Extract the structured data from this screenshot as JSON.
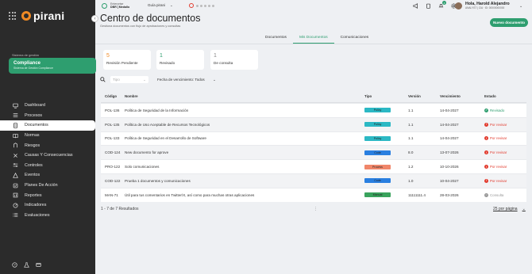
{
  "brand": {
    "name": "pirani"
  },
  "sidebar": {
    "system_caption": "Sistema de gestión",
    "system_title": "Compliance",
    "system_subtitle": "Sistema de Gestión Compliance",
    "items": [
      {
        "label": "Dashboard",
        "icon": "monitor-icon",
        "active": false
      },
      {
        "label": "Procesos",
        "icon": "process-icon",
        "active": false
      },
      {
        "label": "Documentos",
        "icon": "document-icon",
        "active": true
      },
      {
        "label": "Normas",
        "icon": "book-icon",
        "active": false
      },
      {
        "label": "Riesgos",
        "icon": "risk-icon",
        "active": false
      },
      {
        "label": "Causas Y Consecuencias",
        "icon": "cause-icon",
        "active": false
      },
      {
        "label": "Controles",
        "icon": "controls-icon",
        "active": false
      },
      {
        "label": "Eventos",
        "icon": "alert-icon",
        "active": false
      },
      {
        "label": "Planes De Acción",
        "icon": "plan-icon",
        "active": false
      },
      {
        "label": "Reportes",
        "icon": "report-icon",
        "active": false
      },
      {
        "label": "Indicadores",
        "icon": "indicator-icon",
        "active": false
      },
      {
        "label": "Evaluaciones",
        "icon": "evaluation-icon",
        "active": false
      }
    ]
  },
  "topbar": {
    "company_line1": "Enterprise",
    "company_line2": "DBR | Medallo",
    "guide_label": "Guía pirani",
    "user_name": "Hola, Harold Alejandro",
    "user_role": "ANALYST | CIA · ID: 00000000000",
    "notification_count": "4"
  },
  "header": {
    "title": "Centro de documentos",
    "subtitle": "Gestiona documentos con flujo de aprobaciones y consultas",
    "new_button": "Nuevo documento"
  },
  "tabs": [
    {
      "label": "Documentos",
      "active": false
    },
    {
      "label": "Mis Documentos",
      "active": true
    },
    {
      "label": "Comunicaciones",
      "active": false
    }
  ],
  "stats": [
    {
      "value": "5",
      "label": "Revisión Pendiente",
      "color": "#f08a24"
    },
    {
      "value": "1",
      "label": "Revisado",
      "color": "#2e9e6f"
    },
    {
      "value": "1",
      "label": "De consulta",
      "color": "#888888"
    }
  ],
  "filters": {
    "type_placeholder": "Tipo",
    "date_filter": "Fecha de vencimiento: Todos"
  },
  "table": {
    "headers": [
      "Código",
      "Nombre",
      "Tipo",
      "Versión",
      "Vencimiento",
      "Estado"
    ],
    "rows": [
      {
        "code": "POL-136",
        "name": "Política de Seguridad de la Información",
        "type": "Policy",
        "type_color": "#2bb8c4",
        "version": "1.1",
        "due": "14-04-2027",
        "status": "Revisado",
        "status_color": "#2e9e6f",
        "status_icon": "✓"
      },
      {
        "code": "POL-135",
        "name": "Política de Uso Aceptable de Recursos Tecnológicos",
        "type": "Policy",
        "type_color": "#2bb8c4",
        "version": "1.1",
        "due": "14-04-2027",
        "status": "Por revisar",
        "status_color": "#e23b2e",
        "status_icon": "!"
      },
      {
        "code": "POL-133",
        "name": "Política de Seguridad en el Desarrollo de Software",
        "type": "Policy",
        "type_color": "#2bb8c4",
        "version": "1.1",
        "due": "14-04-2027",
        "status": "Por revisar",
        "status_color": "#e23b2e",
        "status_icon": "!"
      },
      {
        "code": "COD-124",
        "name": "New documento for aprove",
        "type": "Code",
        "type_color": "#2a7fe0",
        "version": "8.0",
        "due": "13-07-2026",
        "status": "Por revisar",
        "status_color": "#e23b2e",
        "status_icon": "!"
      },
      {
        "code": "PRO-122",
        "name": "Solo comunicaciones",
        "type": "Process",
        "type_color": "#f0866a",
        "version": "1.2",
        "due": "10-10-2026",
        "status": "Por revisar",
        "status_color": "#e23b2e",
        "status_icon": "!"
      },
      {
        "code": "COD-122",
        "name": "Prueba 1 documentos y comunicaciones",
        "type": "Code",
        "type_color": "#2a7fe0",
        "version": "1.0",
        "due": "10-04-2027",
        "status": "Por revisar",
        "status_color": "#e23b2e",
        "status_icon": "!"
      },
      {
        "code": "MAN-71",
        "name": "Útil para tus comentarios en Twitter/X, así como para muchas otras aplicaciones",
        "type": "Manual",
        "type_color": "#3aa35d",
        "version": "11111111.4",
        "due": "28-03-2026",
        "status": "Consulta",
        "status_color": "#999999",
        "status_icon": "○"
      }
    ]
  },
  "pagination": {
    "results": "1 - 7 de 7 Resultados",
    "more": "⋮",
    "per_page": "25 por página"
  }
}
